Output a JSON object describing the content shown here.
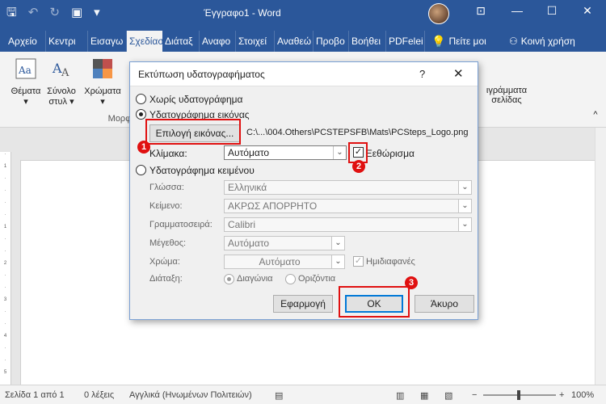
{
  "window": {
    "title": "Έγγραφο1 - Word"
  },
  "tabs": [
    "Αρχείο",
    "Κεντρι",
    "Εισαγω",
    "Σχεδίασ",
    "Διάταξ",
    "Αναφο",
    "Στοιχεί",
    "Αναθεώ",
    "Προβο",
    "Βοήθει",
    "PDFelei",
    "Πείτε μοι",
    "Κοινή χρήση"
  ],
  "ribbon": {
    "themes": "Θέματα",
    "style_set_1": "Σύνολο",
    "style_set_2": "στυλ",
    "colors": "Χρώματα",
    "group_label": "Μορφ",
    "page_colors_1": "ιγράμματα",
    "page_colors_2": "σελίδας"
  },
  "dialog": {
    "title": "Εκτύπωση υδατογραφήματος",
    "help": "?",
    "close": "✕",
    "no_watermark": "Χωρίς υδατογράφημα",
    "picture_watermark": "Υδατογράφημα εικόνας",
    "select_picture": "Επιλογή εικόνας...",
    "picture_path": "C:\\...\\004.Others\\PCSTEPSFB\\Mats\\PCSteps_Logo.png",
    "scale_label": "Κλίμακα:",
    "scale_value": "Αυτόματο",
    "washout_label": "Ξεθώρισμα",
    "text_watermark": "Υδατογράφημα κειμένου",
    "language_label": "Γλώσσα:",
    "language_value": "Ελληνικά",
    "text_label": "Κείμενο:",
    "text_value": "ΑΚΡΩΣ ΑΠΟΡΡΗΤΟ",
    "font_label": "Γραμματοσειρά:",
    "font_value": "Calibri",
    "size_label": "Μέγεθος:",
    "size_value": "Αυτόματο",
    "color_label": "Χρώμα:",
    "color_value": "Αυτόματο",
    "semitransparent_label": "Ημιδιαφανές",
    "layout_label": "Διάταξη:",
    "diagonal_label": "Διαγώνια",
    "horizontal_label": "Οριζόντια",
    "apply_button": "Εφαρμογή",
    "ok_button": "OK",
    "cancel_button": "Άκυρο"
  },
  "annotations": {
    "badge1": "1",
    "badge2": "2",
    "badge3": "3",
    "color": "#e01010"
  },
  "status": {
    "page": "Σελίδα 1 από 1",
    "words": "0 λέξεις",
    "language": "Αγγλικά (Ηνωμένων Πολιτειών)",
    "zoom_minus": "−",
    "zoom_plus": "+",
    "zoom": "100%"
  },
  "colors": {
    "accent": "#2b579a",
    "ribbon": "#f3f3f3"
  }
}
